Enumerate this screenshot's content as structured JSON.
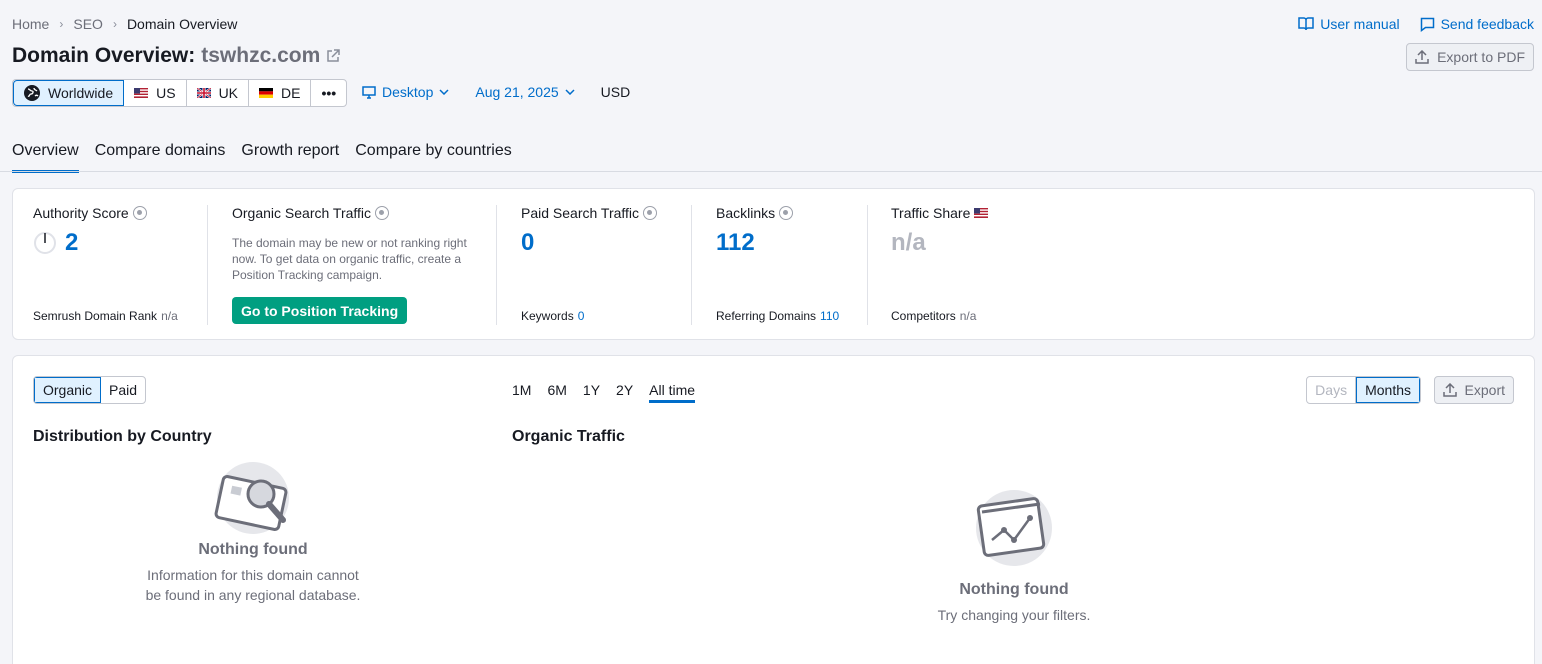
{
  "breadcrumb": [
    "Home",
    "SEO",
    "Domain Overview"
  ],
  "top_links": {
    "manual": "User manual",
    "feedback": "Send feedback"
  },
  "title": {
    "prefix": "Domain Overview:",
    "domain": "tswhzc.com"
  },
  "export_pdf": "Export to PDF",
  "databases": [
    {
      "label": "Worldwide",
      "icon": "globe-icon",
      "active": true
    },
    {
      "label": "US",
      "icon": "us-flag-icon"
    },
    {
      "label": "UK",
      "icon": "uk-flag-icon"
    },
    {
      "label": "DE",
      "icon": "de-flag-icon"
    },
    {
      "label": "•••",
      "icon": "more-icon"
    }
  ],
  "device": "Desktop",
  "date": "Aug 21, 2025",
  "currency": "USD",
  "tabs": [
    "Overview",
    "Compare domains",
    "Growth report",
    "Compare by countries"
  ],
  "metrics": {
    "authority": {
      "label": "Authority Score",
      "value": "2",
      "sub_label": "Semrush Domain Rank",
      "sub_value": "n/a"
    },
    "organic": {
      "label": "Organic Search Traffic",
      "note": "The domain may be new or not ranking right now. To get data on organic traffic, create a Position Tracking campaign.",
      "button": "Go to Position Tracking"
    },
    "paid": {
      "label": "Paid Search Traffic",
      "value": "0",
      "sub_label": "Keywords",
      "sub_value": "0"
    },
    "backlinks": {
      "label": "Backlinks",
      "value": "112",
      "sub_label": "Referring Domains",
      "sub_value": "110"
    },
    "traffic_share": {
      "label": "Traffic Share",
      "value": "n/a",
      "sub_label": "Competitors",
      "sub_value": "n/a"
    }
  },
  "traffic_type": [
    "Organic",
    "Paid"
  ],
  "periods": [
    "1M",
    "6M",
    "1Y",
    "2Y",
    "All time"
  ],
  "granularity": [
    "Days",
    "Months"
  ],
  "export": "Export",
  "distribution": {
    "title": "Distribution by Country",
    "empty_title": "Nothing found",
    "empty_desc_1": "Information for this domain cannot",
    "empty_desc_2": "be found in any regional database."
  },
  "organic_traffic": {
    "title": "Organic Traffic",
    "empty_title": "Nothing found",
    "empty_desc": "Try changing your filters."
  },
  "colors": {
    "accent": "#006dca",
    "green": "#009f81"
  }
}
